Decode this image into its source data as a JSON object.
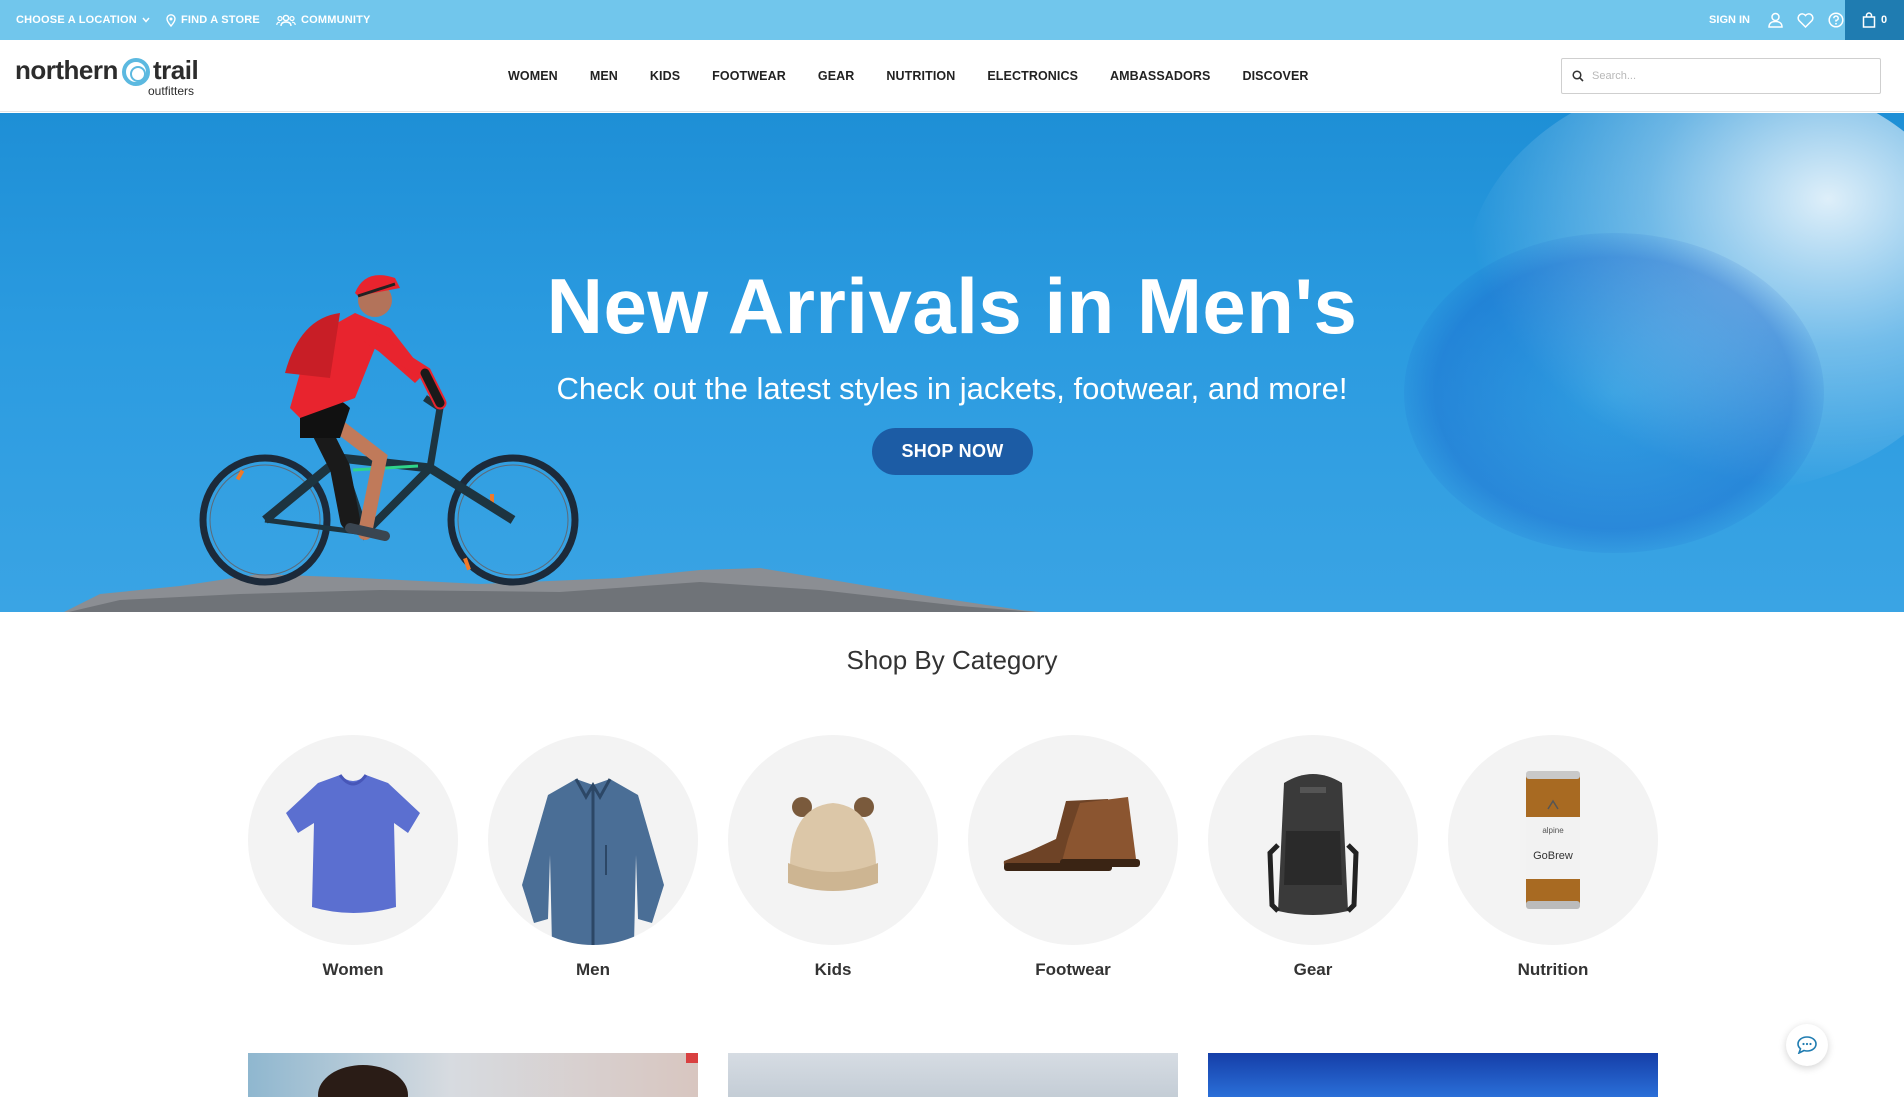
{
  "utility": {
    "choose_location": "CHOOSE A LOCATION",
    "find_store": "FIND A STORE",
    "community": "COMMUNITY",
    "sign_in": "SIGN IN",
    "cart_count": "0"
  },
  "brand": {
    "name_part1": "northern",
    "name_part2": "trail",
    "tagline": "outfitters",
    "accent_color": "#71c6ec",
    "dark_accent": "#1f7cb1"
  },
  "nav": {
    "items": [
      "WOMEN",
      "MEN",
      "KIDS",
      "FOOTWEAR",
      "GEAR",
      "NUTRITION",
      "ELECTRONICS",
      "AMBASSADORS",
      "DISCOVER"
    ]
  },
  "search": {
    "placeholder": "Search..."
  },
  "hero": {
    "title": "New Arrivals in Men's",
    "subtitle": "Check out the latest styles in jackets, footwear, and more!",
    "button": "SHOP NOW"
  },
  "categories": {
    "title": "Shop By Category",
    "items": [
      {
        "label": "Women",
        "icon": "tshirt-icon"
      },
      {
        "label": "Men",
        "icon": "jacket-icon"
      },
      {
        "label": "Kids",
        "icon": "beanie-icon"
      },
      {
        "label": "Footwear",
        "icon": "boot-icon"
      },
      {
        "label": "Gear",
        "icon": "backpack-icon"
      },
      {
        "label": "Nutrition",
        "icon": "can-icon"
      }
    ],
    "can_brand": "alpine",
    "can_product": "GoBrew"
  }
}
